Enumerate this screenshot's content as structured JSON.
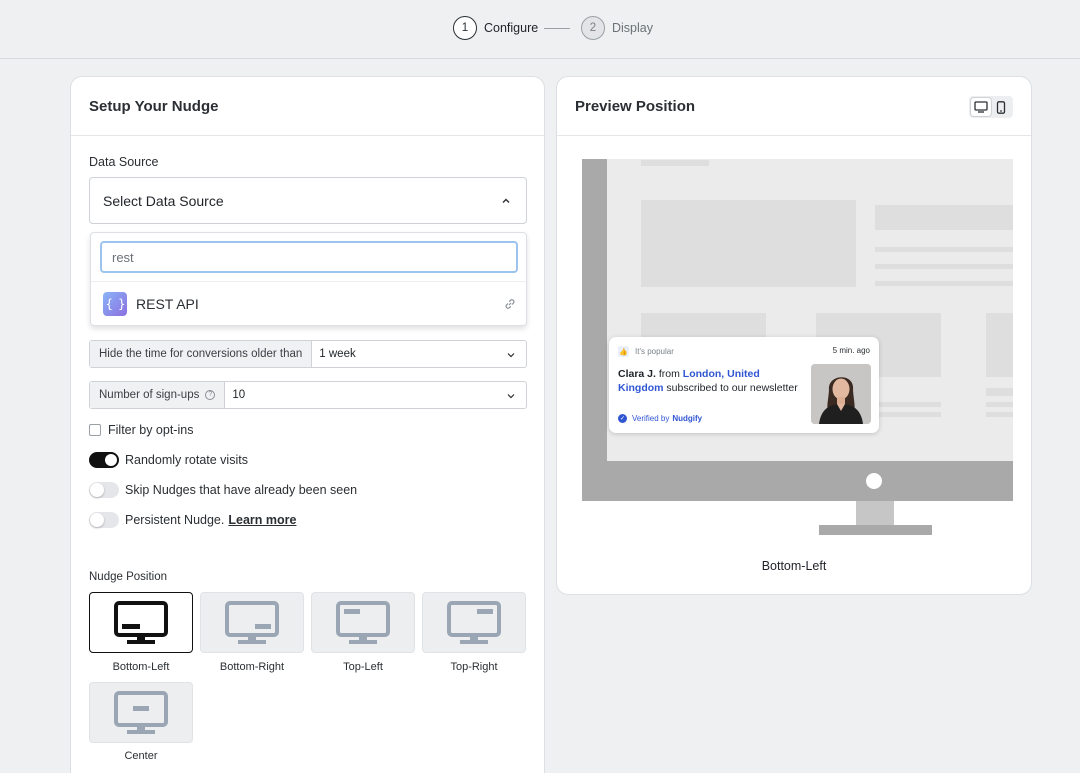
{
  "stepper": {
    "steps": [
      {
        "num": "1",
        "label": "Configure"
      },
      {
        "num": "2",
        "label": "Display"
      }
    ]
  },
  "setup": {
    "title": "Setup Your Nudge",
    "data_source_label": "Data Source",
    "data_source_value": "Select Data Source",
    "dropdown": {
      "search_value": "rest",
      "items": [
        {
          "label": "REST API",
          "icon": "curly-braces-icon"
        }
      ]
    },
    "hide_time": {
      "prefix": "Hide the time for conversions older than",
      "value": "1 week"
    },
    "signups": {
      "prefix": "Number of sign-ups",
      "value": "10"
    },
    "options": {
      "filter_optins": {
        "label": "Filter by opt-ins",
        "checked": false
      },
      "rotate_visits": {
        "label": "Randomly rotate visits",
        "on": true
      },
      "skip_seen": {
        "label": "Skip Nudges that have already been seen",
        "on": false
      },
      "persistent": {
        "label": "Persistent Nudge.",
        "link": "Learn more",
        "on": false
      }
    },
    "position_label": "Nudge Position",
    "positions": [
      {
        "label": "Bottom-Left",
        "selected": true
      },
      {
        "label": "Bottom-Right",
        "selected": false
      },
      {
        "label": "Top-Left",
        "selected": false
      },
      {
        "label": "Top-Right",
        "selected": false
      },
      {
        "label": "Center",
        "selected": false
      }
    ]
  },
  "preview": {
    "title": "Preview Position",
    "devices": [
      "desktop-icon",
      "mobile-icon"
    ],
    "nudge": {
      "badge": "It's popular",
      "time": "5 min. ago",
      "name": "Clara J.",
      "from": "from",
      "location": "London, United Kingdom",
      "action": "subscribed to our newsletter",
      "verified_prefix": "Verified by",
      "verified_brand": "Nudgify"
    },
    "position_caption": "Bottom-Left"
  },
  "colors": {
    "accent_blue": "#3056d3",
    "selected_border": "#111111",
    "focus_ring": "#9cc4ee"
  }
}
